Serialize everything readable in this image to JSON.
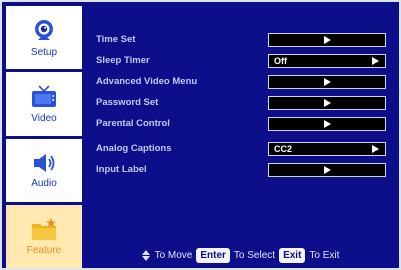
{
  "sidebar": {
    "items": [
      {
        "label": "Setup",
        "icon": "webcam-icon",
        "active": false
      },
      {
        "label": "Video",
        "icon": "tv-icon",
        "active": false
      },
      {
        "label": "Audio",
        "icon": "speaker-icon",
        "active": false
      },
      {
        "label": "Feature",
        "icon": "folder-star-icon",
        "active": true
      }
    ]
  },
  "menu": {
    "items": [
      {
        "label": "Time Set",
        "value": "",
        "arrow": "center"
      },
      {
        "label": "Sleep Timer",
        "value": "Off",
        "arrow": "right"
      },
      {
        "label": "Advanced Video Menu",
        "value": "",
        "arrow": "center"
      },
      {
        "label": "Password Set",
        "value": "",
        "arrow": "center"
      },
      {
        "label": "Parental Control",
        "value": "",
        "arrow": "center"
      },
      {
        "label": "Analog Captions",
        "value": "CC2",
        "arrow": "right"
      },
      {
        "label": "Input Label",
        "value": "",
        "arrow": "center"
      }
    ]
  },
  "footer": {
    "move_text": "To Move",
    "enter_key": "Enter",
    "select_text": "To Select",
    "exit_key": "Exit",
    "exit_text": "To Exit"
  },
  "colors": {
    "background": "#0c0e8a",
    "label_text": "#c4c9f2",
    "sidebar_label": "#1a32c8",
    "active_label": "#f08a1a",
    "value_box": "#000000"
  }
}
